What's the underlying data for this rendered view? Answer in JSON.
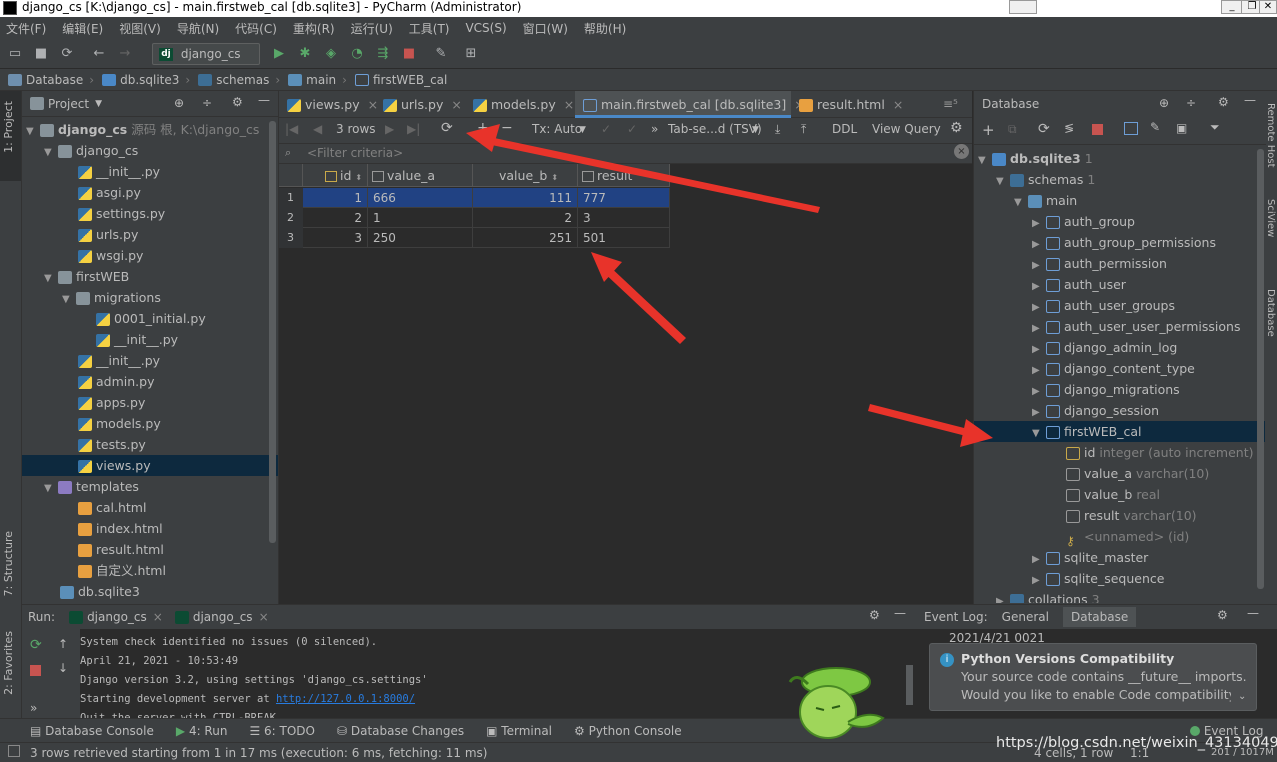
{
  "window": {
    "title": "django_cs [K:\\django_cs] - main.firstweb_cal [db.sqlite3] - PyCharm (Administrator)"
  },
  "menu": [
    "文件(F)",
    "编辑(E)",
    "视图(V)",
    "导航(N)",
    "代码(C)",
    "重构(R)",
    "运行(U)",
    "工具(T)",
    "VCS(S)",
    "窗口(W)",
    "帮助(H)"
  ],
  "toolbar": {
    "run_config": "django_cs"
  },
  "breadcrumb": [
    "Database",
    "db.sqlite3",
    "schemas",
    "main",
    "firstWEB_cal"
  ],
  "left_strip": {
    "project_tab": "1: Project",
    "structure_tab": "7: Structure",
    "favorites_tab": "2: Favorites"
  },
  "right_strip": {
    "remote_host": "Remote Host",
    "sciview": "SciView",
    "database": "Database"
  },
  "project": {
    "title": "Project",
    "root": "django_cs",
    "root_meta": "源码 根, K:\\django_cs",
    "items": [
      "django_cs",
      "__init__.py",
      "asgi.py",
      "settings.py",
      "urls.py",
      "wsgi.py",
      "firstWEB",
      "migrations",
      "0001_initial.py",
      "__init__.py",
      "__init__.py",
      "admin.py",
      "apps.py",
      "models.py",
      "tests.py",
      "views.py",
      "templates",
      "cal.html",
      "index.html",
      "result.html",
      "自定义.html",
      "db.sqlite3"
    ]
  },
  "editor": {
    "tabs": [
      "views.py",
      "urls.py",
      "models.py",
      "main.firstweb_cal [db.sqlite3]",
      "result.html"
    ],
    "rows_label": "3 rows",
    "tx_label": "Tx: Auto",
    "format_label": "Tab-se...d (TSV)",
    "ddl_label": "DDL",
    "view_query_label": "View Query",
    "filter_placeholder": "<Filter criteria>",
    "columns": [
      "id",
      "value_a",
      "value_b",
      "result"
    ],
    "rows": [
      {
        "n": "1",
        "id": "1",
        "value_a": "666",
        "value_b": "111",
        "result": "777"
      },
      {
        "n": "2",
        "id": "2",
        "value_a": "1",
        "value_b": "2",
        "result": "3"
      },
      {
        "n": "3",
        "id": "3",
        "value_a": "250",
        "value_b": "251",
        "result": "501"
      }
    ]
  },
  "database": {
    "title": "Database",
    "root": "db.sqlite3",
    "root_count": "1",
    "schemas": "schemas",
    "schemas_count": "1",
    "main": "main",
    "tables": [
      "auth_group",
      "auth_group_permissions",
      "auth_permission",
      "auth_user",
      "auth_user_groups",
      "auth_user_user_permissions",
      "django_admin_log",
      "django_content_type",
      "django_migrations",
      "django_session",
      "firstWEB_cal"
    ],
    "columns": [
      {
        "name": "id",
        "type": "integer (auto increment)"
      },
      {
        "name": "value_a",
        "type": "varchar(10)"
      },
      {
        "name": "value_b",
        "type": "real"
      },
      {
        "name": "result",
        "type": "varchar(10)"
      },
      {
        "name": "",
        "type": "<unnamed> (id)"
      }
    ],
    "after_tables": [
      "sqlite_master",
      "sqlite_sequence"
    ],
    "collations": "collations",
    "collations_count": "3"
  },
  "run": {
    "label": "Run:",
    "tab1": "django_cs",
    "tab2": "django_cs",
    "console": [
      "System check identified no issues (0 silenced).",
      "April 21, 2021 - 10:53:49",
      "Django version 3.2, using settings 'django_cs.settings'",
      "Starting development server at ",
      "Quit the server with CTRL-BREAK."
    ],
    "link": "http://127.0.0.1:8000/"
  },
  "event_log": {
    "label": "Event Log:",
    "tabs": [
      "General",
      "Database"
    ],
    "date": "2021/4/21 0021",
    "notice_title": "Python Versions Compatibility",
    "notice_line1": "Your source code contains __future__ imports.",
    "notice_line2": "Would you like to enable Code compatibility..."
  },
  "tool_windows": [
    "Database Console",
    "4: Run",
    "6: TODO",
    "Database Changes",
    "Terminal",
    "Python Console",
    "Event Log"
  ],
  "status": {
    "text": "3 rows retrieved starting from 1 in 17 ms (execution: 6 ms, fetching: 11 ms)",
    "cells": "4 cells, 1 row",
    "pos": "1:1",
    "mem": "201 / 1017M"
  },
  "watermark": "https://blog.csdn.net/weixin_43134049",
  "colors": {
    "accent": "#4a88c7",
    "selection": "#214283",
    "arrow": "#e8332a"
  }
}
